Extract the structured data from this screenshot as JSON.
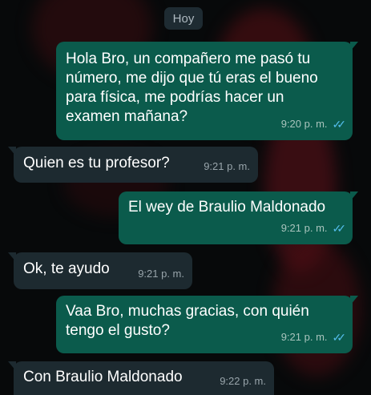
{
  "date_chip": "Hoy",
  "colors": {
    "outgoing_bubble": "#0b5b4c",
    "incoming_bubble": "#1d2a30",
    "read_ticks": "#53bdeb",
    "background": "#07090a"
  },
  "read_receipt_icon": "double-check-icon",
  "messages": [
    {
      "direction": "outgoing",
      "lines": [
        "Hola Bro, un compañero me pasó tu",
        "número, me dijo que tú eras el bueno",
        "para física, me podrías hacer un",
        "examen mañana?"
      ],
      "time": "9:20 p. m.",
      "read": true
    },
    {
      "direction": "incoming",
      "lines": [
        "Quien es tu profesor?"
      ],
      "time": "9:21 p. m."
    },
    {
      "direction": "outgoing",
      "lines": [
        "El wey de Braulio Maldonado"
      ],
      "time": "9:21 p. m.",
      "read": true
    },
    {
      "direction": "incoming",
      "lines": [
        "Ok, te ayudo"
      ],
      "time": "9:21 p. m."
    },
    {
      "direction": "outgoing",
      "lines": [
        "Vaa Bro, muchas gracias, con quién",
        "tengo el gusto?"
      ],
      "time": "9:21 p. m.",
      "read": true
    },
    {
      "direction": "incoming",
      "lines": [
        "Con Braulio Maldonado"
      ],
      "time": "9:22 p. m."
    }
  ]
}
